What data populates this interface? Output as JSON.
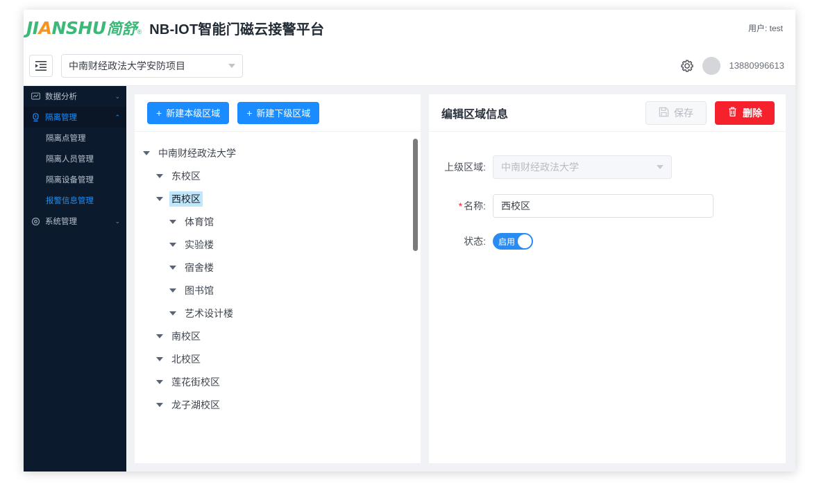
{
  "header": {
    "logo_main": "JI",
    "logo_accent": "A",
    "logo_rest": "NSHU",
    "logo_cn": "简舒",
    "logo_reg": "®",
    "app_title": "NB-IOT智能门磁云接警平台",
    "user_label": "用户: test"
  },
  "toolbar": {
    "collapse_icon": "menu-fold-icon",
    "project": "中南财经政法大学安防项目",
    "gear_icon": "gear-icon",
    "avatar_icon": "avatar",
    "phone": "13880996613"
  },
  "sidebar": {
    "items": [
      {
        "label": "数据分析",
        "icon": "chart-icon",
        "arrow": "⌄",
        "expanded": false
      },
      {
        "label": "隔离管理",
        "icon": "door-sensor-icon",
        "arrow": "⌃",
        "expanded": true
      },
      {
        "label": "系统管理",
        "icon": "gear-icon",
        "arrow": "⌄",
        "expanded": false
      }
    ],
    "subitems": [
      {
        "label": "隔离点管理",
        "selected": false
      },
      {
        "label": "隔离人员管理",
        "selected": false
      },
      {
        "label": "隔离设备管理",
        "selected": false
      },
      {
        "label": "报警信息管理",
        "selected": true
      }
    ]
  },
  "tree_panel": {
    "new_same_level_label": "新建本级区域",
    "new_sub_level_label": "新建下级区域",
    "plus": "+",
    "nodes": [
      {
        "label": "中南财经政法大学",
        "level": 0,
        "selected": false
      },
      {
        "label": "东校区",
        "level": 1,
        "selected": false
      },
      {
        "label": "西校区",
        "level": 1,
        "selected": true
      },
      {
        "label": "体育馆",
        "level": 2,
        "selected": false
      },
      {
        "label": "实验楼",
        "level": 2,
        "selected": false
      },
      {
        "label": "宿舍楼",
        "level": 2,
        "selected": false
      },
      {
        "label": "图书馆",
        "level": 2,
        "selected": false
      },
      {
        "label": "艺术设计楼",
        "level": 2,
        "selected": false
      },
      {
        "label": "南校区",
        "level": 1,
        "selected": false
      },
      {
        "label": "北校区",
        "level": 1,
        "selected": false
      },
      {
        "label": "莲花街校区",
        "level": 1,
        "selected": false
      },
      {
        "label": "龙子湖校区",
        "level": 1,
        "selected": false
      }
    ]
  },
  "form_panel": {
    "title": "编辑区域信息",
    "save_label": "保存",
    "save_icon": "save-icon",
    "delete_label": "删除",
    "delete_icon": "trash-icon",
    "parent_label": "上级区域:",
    "parent_value": "中南财经政法大学",
    "name_label": "名称:",
    "name_required_mark": "*",
    "name_value": "西校区",
    "status_label": "状态:",
    "status_value": "启用"
  },
  "colors": {
    "brand_green": "#3cb878",
    "brand_orange": "#f7941e",
    "primary_blue": "#1a8cff",
    "danger_red": "#f5222d",
    "sidebar_bg": "#0c1a2d",
    "selected_tree": "#bfe6fb"
  }
}
